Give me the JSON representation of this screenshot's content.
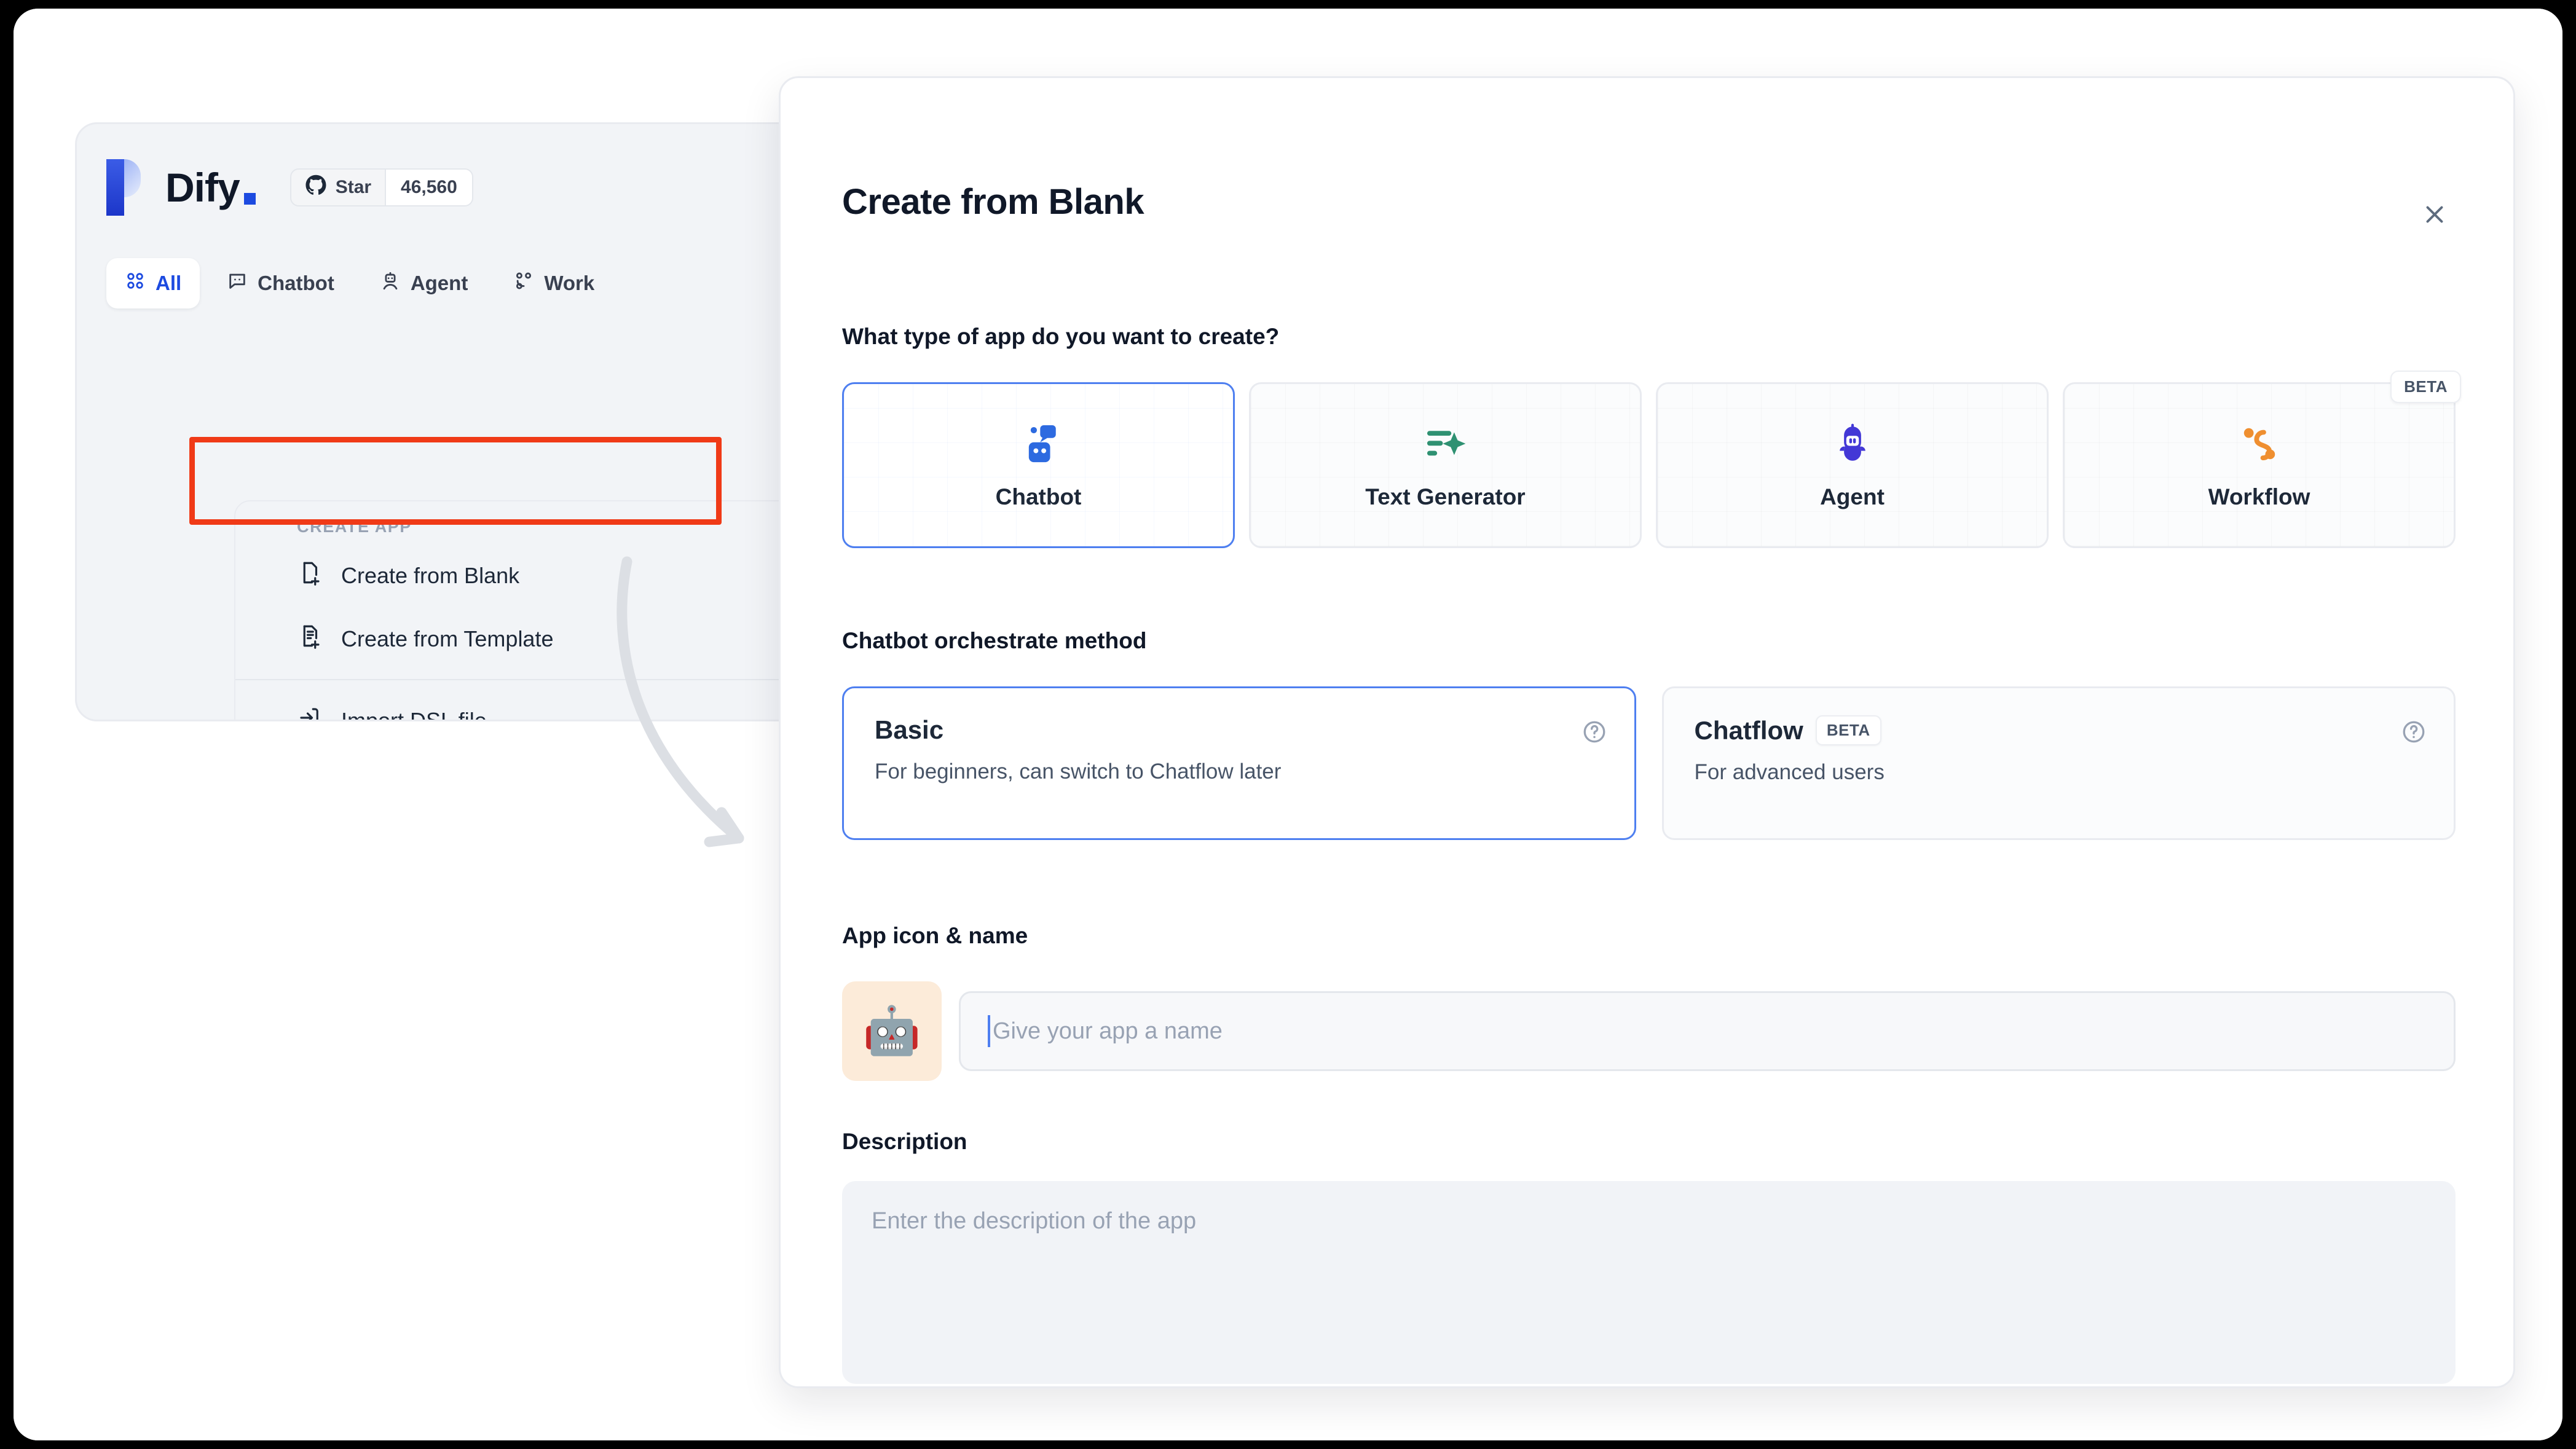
{
  "brand": {
    "wordmark": "Dify",
    "github": {
      "star_label": "Star",
      "star_count": "46,560"
    }
  },
  "tabs": [
    {
      "label": "All",
      "icon": "grid-icon",
      "active": true
    },
    {
      "label": "Chatbot",
      "icon": "chat-bubble-icon",
      "active": false
    },
    {
      "label": "Agent",
      "icon": "agent-robot-icon",
      "active": false
    },
    {
      "label": "Work",
      "icon": "workflow-nodes-icon",
      "active": false
    }
  ],
  "create_app_menu": {
    "header": "CREATE APP",
    "items": [
      {
        "label": "Create from Blank",
        "icon": "blank-page-plus-icon"
      },
      {
        "label": "Create from Template",
        "icon": "template-page-plus-icon"
      },
      {
        "label": "Import DSL file",
        "icon": "import-arrow-icon"
      }
    ]
  },
  "annotation": {
    "highlight_color": "#f03a17",
    "arrow_color": "#dcdfe4"
  },
  "modal": {
    "title": "Create from Blank",
    "close_icon": "close-icon",
    "app_type": {
      "label": "What type of app do you want to create?",
      "options": [
        {
          "name": "Chatbot",
          "icon": "chatbot-icon",
          "color": "#2d6ae0",
          "selected": true,
          "badge": ""
        },
        {
          "name": "Text Generator",
          "icon": "text-sparkle-icon",
          "color": "#2f9172",
          "selected": false,
          "badge": ""
        },
        {
          "name": "Agent",
          "icon": "agent-robot-icon",
          "color": "#4338d6",
          "selected": false,
          "badge": ""
        },
        {
          "name": "Workflow",
          "icon": "workflow-path-icon",
          "color": "#ef8f30",
          "selected": false,
          "badge": "BETA"
        }
      ]
    },
    "orchestrate": {
      "label": "Chatbot orchestrate method",
      "options": [
        {
          "title": "Basic",
          "badge": "",
          "description": "For beginners, can switch to Chatflow later",
          "selected": true,
          "help_icon": "help-circle-icon"
        },
        {
          "title": "Chatflow",
          "badge": "BETA",
          "description": "For advanced users",
          "selected": false,
          "help_icon": "help-circle-icon"
        }
      ]
    },
    "app_icon_name": {
      "label": "App icon & name",
      "icon_emoji": "🤖",
      "icon_background": "#fcebd9",
      "name_value": "",
      "name_placeholder": "Give your app a name"
    },
    "description": {
      "label": "Description",
      "value": "",
      "placeholder": "Enter the description of the app"
    }
  }
}
